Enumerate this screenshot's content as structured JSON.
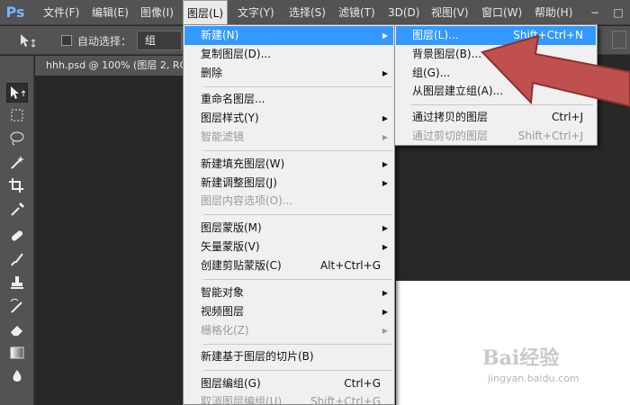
{
  "app": {
    "logo": "Ps"
  },
  "menubar": {
    "items": [
      {
        "label": "文件(F)"
      },
      {
        "label": "编辑(E)"
      },
      {
        "label": "图像(I)"
      },
      {
        "label": "图层(L)"
      },
      {
        "label": "文字(Y)"
      },
      {
        "label": "选择(S)"
      },
      {
        "label": "滤镜(T)"
      },
      {
        "label": "3D(D)"
      },
      {
        "label": "视图(V)"
      },
      {
        "label": "窗口(W)"
      },
      {
        "label": "帮助(H)"
      }
    ],
    "active_index": 3,
    "window_controls": [
      "−",
      "□"
    ]
  },
  "options_bar": {
    "auto_select_label": "自动选择：",
    "auto_select_checked": false,
    "auto_select_value": "组"
  },
  "document": {
    "tab_title": "hhh.psd @ 100% (图层 2, RG"
  },
  "layer_menu": {
    "items": [
      {
        "label": "新建(N)",
        "submenu": true,
        "highlight": true
      },
      {
        "label": "复制图层(D)..."
      },
      {
        "label": "删除",
        "submenu": true
      },
      {
        "label": "重命名图层..."
      },
      {
        "label": "图层样式(Y)",
        "submenu": true
      },
      {
        "label": "智能滤镜",
        "submenu": true,
        "disabled": true
      },
      {
        "label": "新建填充图层(W)",
        "submenu": true
      },
      {
        "label": "新建调整图层(J)",
        "submenu": true
      },
      {
        "label": "图层内容选项(O)...",
        "disabled": true
      },
      {
        "label": "图层蒙版(M)",
        "submenu": true
      },
      {
        "label": "矢量蒙版(V)",
        "submenu": true
      },
      {
        "label": "创建剪贴蒙版(C)",
        "shortcut": "Alt+Ctrl+G"
      },
      {
        "label": "智能对象",
        "submenu": true
      },
      {
        "label": "视频图层",
        "submenu": true
      },
      {
        "label": "栅格化(Z)",
        "submenu": true,
        "disabled": true
      },
      {
        "label": "新建基于图层的切片(B)"
      },
      {
        "label": "图层编组(G)",
        "shortcut": "Ctrl+G"
      },
      {
        "label": "取消图层编组(U)",
        "shortcut": "Shift+Ctrl+G",
        "disabled": true
      }
    ]
  },
  "new_submenu": {
    "items": [
      {
        "label": "图层(L)...",
        "shortcut": "Shift+Ctrl+N",
        "highlight": true
      },
      {
        "label": "背景图层(B)..."
      },
      {
        "label": "组(G)..."
      },
      {
        "label": "从图层建立组(A)..."
      },
      {
        "label": "通过拷贝的图层",
        "shortcut": "Ctrl+J"
      },
      {
        "label": "通过剪切的图层",
        "shortcut": "Shift+Ctrl+J",
        "disabled": true
      }
    ]
  },
  "watermark": {
    "main": "Bai经验",
    "sub": "jingyan.baidu.com"
  },
  "colors": {
    "highlight": "#3399ff",
    "annotation_arrow": "#c0504d",
    "menu_bg": "#f0f0f0"
  }
}
